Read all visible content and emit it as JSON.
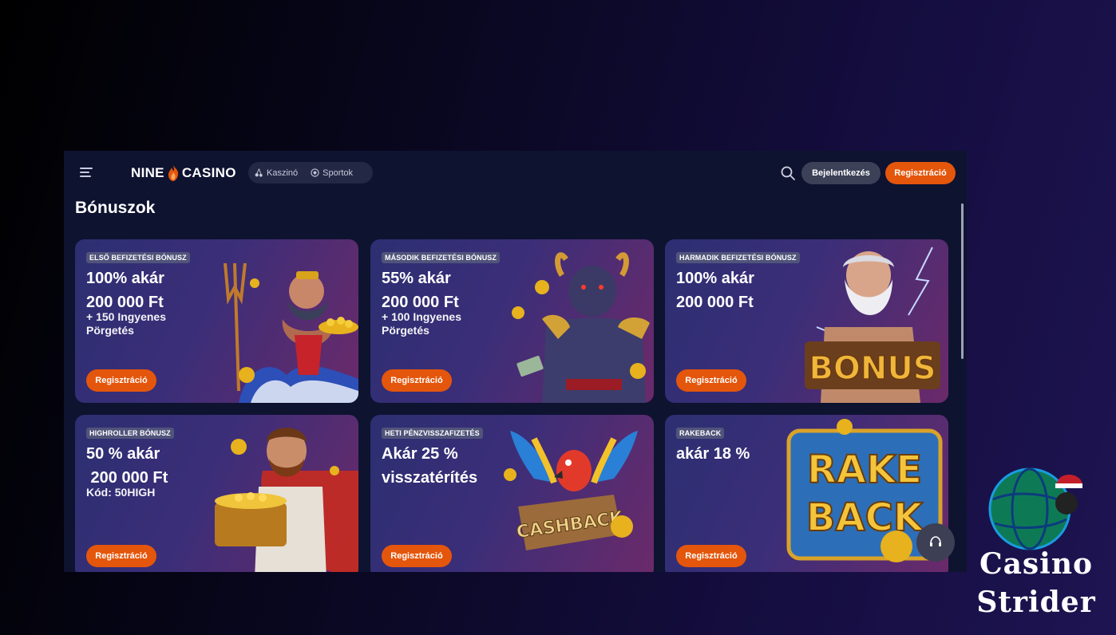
{
  "header": {
    "logo_left": "NINE",
    "logo_right": "CASINO",
    "nav": [
      {
        "label": "Kaszinó",
        "icon": "cherries-icon"
      },
      {
        "label": "Sportok",
        "icon": "soccer-ball-icon"
      }
    ],
    "login_label": "Bejelentkezés",
    "register_label": "Regisztráció"
  },
  "page": {
    "title": "Bónuszok"
  },
  "cards": [
    {
      "tag": "ELSŐ BEFIZETÉSI BÓNUSZ",
      "headline": "100% akár\n200 000 Ft",
      "sub": "+ 150 Ingyenes\nPörgetés",
      "cta": "Regisztráció",
      "art": "poseidon-icon"
    },
    {
      "tag": "MÁSODIK BEFIZETÉSI BÓNUSZ",
      "headline": "55% akár\n200 000 Ft",
      "sub": "+ 100 Ingyenes\nPörgetés",
      "cta": "Regisztráció",
      "art": "minotaur-icon"
    },
    {
      "tag": "HARMADIK BEFIZETÉSI BÓNUSZ",
      "headline": "100% akár\n200 000 Ft",
      "sub": "",
      "cta": "Regisztráció",
      "art": "zeus-bonus-icon",
      "art_text": "BONUS"
    },
    {
      "tag": "HIGHROLLER BÓNUSZ",
      "headline": "50 % akár\n 200 000 Ft",
      "sub": "Kód: 50HIGH",
      "cta": "Regisztráció",
      "art": "treasure-chest-icon"
    },
    {
      "tag": "HETI PÉNZVISSZAFIZETÉS",
      "headline": "Akár 25 %\nvisszatérítés",
      "sub": "",
      "cta": "Regisztráció",
      "art": "parrot-cashback-icon",
      "art_text": "CASHBACK"
    },
    {
      "tag": "RAKEBACK",
      "headline": "akár 18 %",
      "sub": "",
      "cta": "Regisztráció",
      "art": "rakeback-icon",
      "art_text": "RAKE\nBACK"
    }
  ],
  "watermark": {
    "line1": "Casino",
    "line2": "Strider"
  },
  "colors": {
    "accent": "#e4560b",
    "panel": "#0e1330",
    "pill": "#232845",
    "login": "#3c4158"
  }
}
